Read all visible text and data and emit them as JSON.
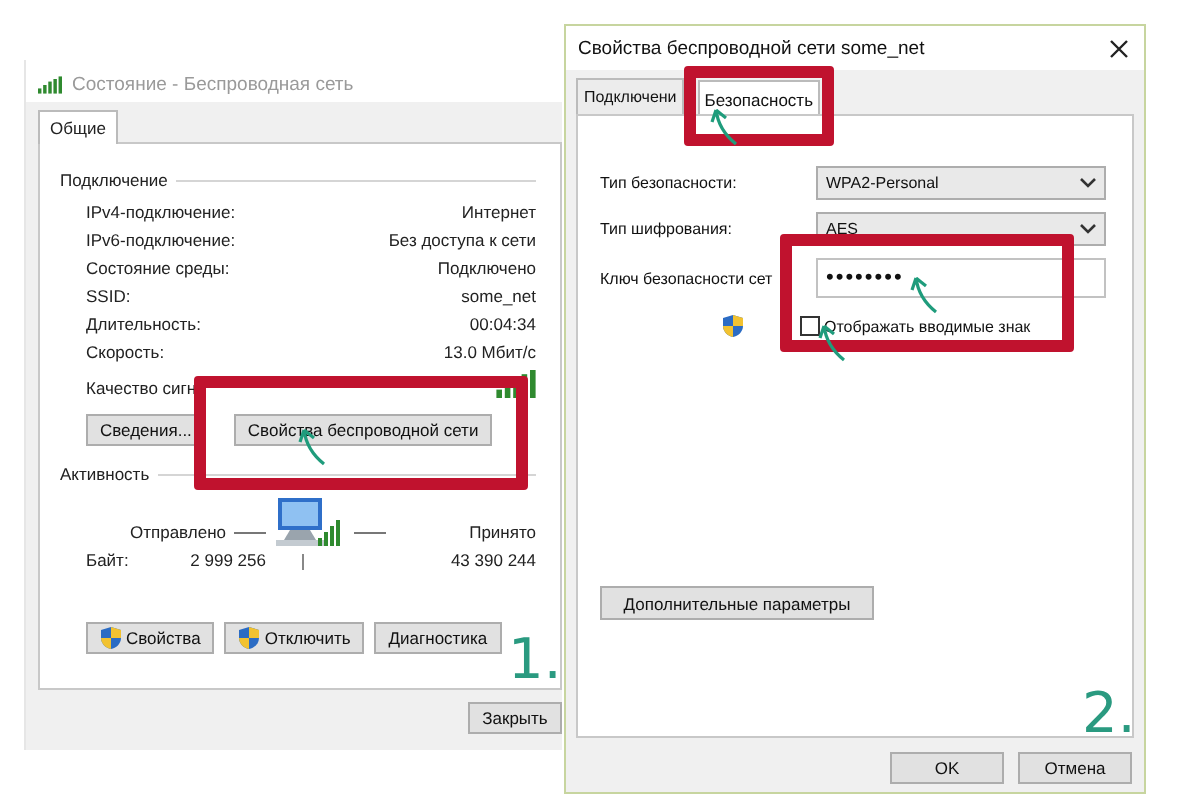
{
  "status_window": {
    "title": "Состояние - Беспроводная сеть",
    "active": false,
    "tabs": [
      {
        "label": "Общие",
        "selected": true
      }
    ],
    "connection": {
      "heading": "Подключение",
      "rows": [
        {
          "label": "IPv4-подключение:",
          "value": "Интернет"
        },
        {
          "label": "IPv6-подключение:",
          "value": "Без доступа к сети"
        },
        {
          "label": "Состояние среды:",
          "value": "Подключено"
        },
        {
          "label": "SSID:",
          "value": "some_net"
        },
        {
          "label": "Длительность:",
          "value": "00:04:34"
        },
        {
          "label": "Скорость:",
          "value": "13.0 Мбит/с"
        }
      ],
      "signal_label": "Качество сигн"
    },
    "buttons": [
      {
        "label": "Сведения..."
      },
      {
        "label": "Свойства беспроводной сети"
      }
    ],
    "activity": {
      "heading": "Активность",
      "sent_label": "Отправлено",
      "received_label": "Принято",
      "bytes_label": "Байт:",
      "bytes_sent": "2 999 256",
      "bytes_received": "43 390 244"
    },
    "action_buttons": [
      {
        "label": "Свойства",
        "shield": true
      },
      {
        "label": "Отключить",
        "shield": true
      },
      {
        "label": "Диагностика",
        "shield": false
      }
    ],
    "close_button": "Закрыть"
  },
  "properties_window": {
    "title": "Свойства беспроводной сети some_net",
    "active": true,
    "tabs": [
      {
        "label": "Подключени",
        "selected": false
      },
      {
        "label": "Безопасность",
        "selected": true
      }
    ],
    "fields": [
      {
        "label": "Тип безопасности:",
        "kind": "dropdown",
        "value": "WPA2-Personal"
      },
      {
        "label": "Тип шифрования:",
        "kind": "dropdown",
        "value": "AES"
      },
      {
        "label": "Ключ безопасности сет",
        "kind": "password",
        "value": "••••••••"
      }
    ],
    "show_characters": {
      "label": "Отображать вводимые знак",
      "checked": false
    },
    "advanced_button": "Дополнительные параметры",
    "buttons": [
      "OK",
      "Отмена"
    ]
  },
  "annotations": {
    "step_labels": [
      "1.",
      "2."
    ]
  }
}
